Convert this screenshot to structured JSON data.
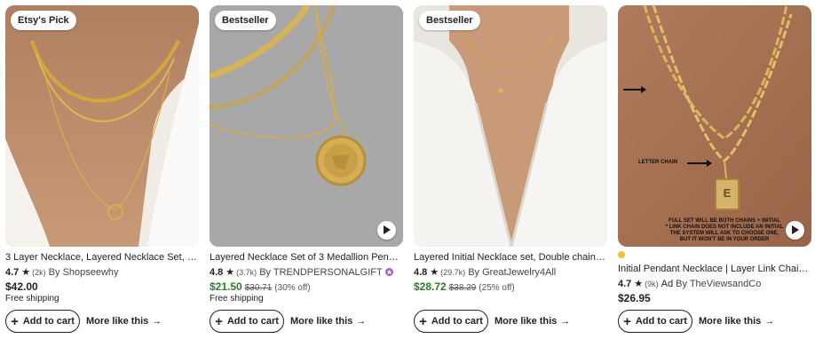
{
  "listings": [
    {
      "badge": "Etsy's Pick",
      "title": "3 Layer Necklace, Layered Necklace Set, Gold Dis...",
      "rating": "4.7",
      "review_count": "(2k)",
      "ad": "",
      "shop": "By Shopseewhy",
      "price": "$42.00",
      "original_price": "",
      "discount": "",
      "shipping": "Free shipping",
      "add_to_cart": "Add to cart",
      "more_like_this": "More like this",
      "has_video": false
    },
    {
      "badge": "Bestseller",
      "title": "Layered Necklace Set of 3 Medallion Pendant 14k ...",
      "rating": "4.8",
      "review_count": "(3.7k)",
      "ad": "",
      "shop": "By TRENDPERSONALGIFT",
      "price": "$21.50",
      "original_price": "$30.71",
      "discount": "(30% off)",
      "shipping": "Free shipping",
      "add_to_cart": "Add to cart",
      "more_like_this": "More like this",
      "has_video": true
    },
    {
      "badge": "Bestseller",
      "title": "Layered Initial Necklace set, Double chain necklac...",
      "rating": "4.8",
      "review_count": "(29.7k)",
      "ad": "",
      "shop": "By GreatJewelry4All",
      "price": "$28.72",
      "original_price": "$38.29",
      "discount": "(25% off)",
      "shipping": "",
      "add_to_cart": "Add to cart",
      "more_like_this": "More like this",
      "has_video": false
    },
    {
      "badge": "",
      "title": "Initial Pendant Necklace | Layer Link Chain | Paper...",
      "rating": "4.7",
      "review_count": "(9k)",
      "ad": "Ad",
      "shop": "By TheViewsandCo",
      "price": "$26.95",
      "original_price": "",
      "discount": "",
      "shipping": "",
      "add_to_cart": "Add to cart",
      "more_like_this": "More like this",
      "has_video": true,
      "image_text": {
        "letter_chain": "LETTER CHAIN",
        "note_line1": "FULL SET WILL BE BOTH CHAINS + INITIAL",
        "note_line2": "* LINK CHAIN DOES NOT INCLUDE AN INITIAL",
        "note_line3": "THE SYSTEM WILL ASK TO CHOOSE ONE,",
        "note_line4": "BUT IT WON'T BE IN YOUR ORDER",
        "pendant_letter": "E"
      }
    }
  ],
  "icons": {
    "star": "star-icon",
    "plus": "plus-icon",
    "arrow": "arrow-right-icon",
    "play": "play-icon",
    "verified": "star-seller-icon"
  },
  "colors": {
    "sale_price": "#2d7b2d",
    "text": "#222222",
    "verified_badge": "#a25bd6",
    "ad_dot": "#f1c232"
  },
  "glyphs": {
    "star": "★",
    "plus": "+",
    "arrow": "→"
  }
}
